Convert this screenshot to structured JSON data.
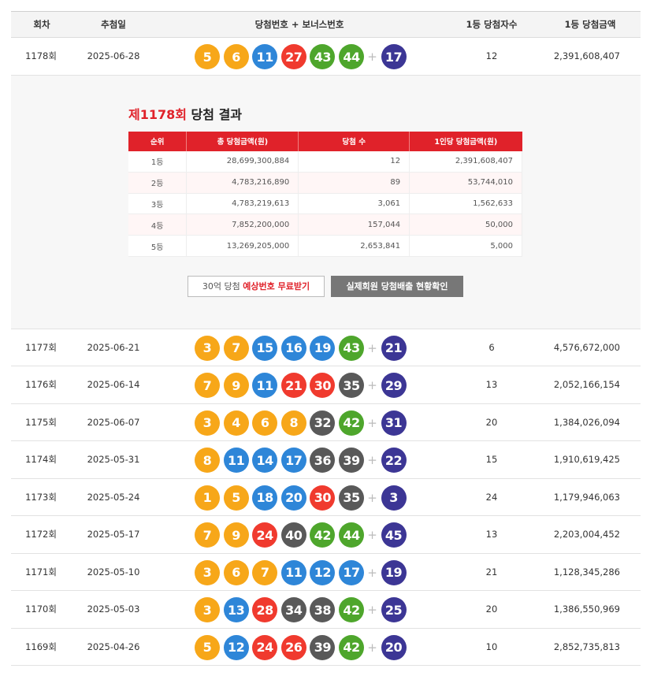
{
  "colors": {
    "yellow": "#f7a719",
    "blue": "#2e86d8",
    "red": "#f03a2e",
    "gray": "#595959",
    "green": "#4ea62c",
    "bonus": "#3c3695"
  },
  "header": {
    "round": "회차",
    "date": "추첨일",
    "numbers": "당첨번호 + 보너스번호",
    "winners": "1등 당첨자수",
    "amount": "1등 당첨금액"
  },
  "plus": "+",
  "draws": [
    {
      "round": "1178회",
      "date": "2025-06-28",
      "nums": [
        5,
        6,
        11,
        27,
        43,
        44
      ],
      "bonus": 17,
      "winners": "12",
      "amount": "2,391,608,407"
    },
    {
      "round": "1177회",
      "date": "2025-06-21",
      "nums": [
        3,
        7,
        15,
        16,
        19,
        43
      ],
      "bonus": 21,
      "winners": "6",
      "amount": "4,576,672,000"
    },
    {
      "round": "1176회",
      "date": "2025-06-14",
      "nums": [
        7,
        9,
        11,
        21,
        30,
        35
      ],
      "bonus": 29,
      "winners": "13",
      "amount": "2,052,166,154"
    },
    {
      "round": "1175회",
      "date": "2025-06-07",
      "nums": [
        3,
        4,
        6,
        8,
        32,
        42
      ],
      "bonus": 31,
      "winners": "20",
      "amount": "1,384,026,094"
    },
    {
      "round": "1174회",
      "date": "2025-05-31",
      "nums": [
        8,
        11,
        14,
        17,
        36,
        39
      ],
      "bonus": 22,
      "winners": "15",
      "amount": "1,910,619,425"
    },
    {
      "round": "1173회",
      "date": "2025-05-24",
      "nums": [
        1,
        5,
        18,
        20,
        30,
        35
      ],
      "bonus": 3,
      "winners": "24",
      "amount": "1,179,946,063"
    },
    {
      "round": "1172회",
      "date": "2025-05-17",
      "nums": [
        7,
        9,
        24,
        40,
        42,
        44
      ],
      "bonus": 45,
      "winners": "13",
      "amount": "2,203,004,452"
    },
    {
      "round": "1171회",
      "date": "2025-05-10",
      "nums": [
        3,
        6,
        7,
        11,
        12,
        17
      ],
      "bonus": 19,
      "winners": "21",
      "amount": "1,128,345,286"
    },
    {
      "round": "1170회",
      "date": "2025-05-03",
      "nums": [
        3,
        13,
        28,
        34,
        38,
        42
      ],
      "bonus": 25,
      "winners": "20",
      "amount": "1,386,550,969"
    },
    {
      "round": "1169회",
      "date": "2025-04-26",
      "nums": [
        5,
        12,
        24,
        26,
        39,
        42
      ],
      "bonus": 20,
      "winners": "10",
      "amount": "2,852,735,813"
    }
  ],
  "detail": {
    "title_red": "제1178회",
    "title_rest": " 당첨 결과",
    "columns": [
      "순위",
      "총 당첨금액(원)",
      "당첨 수",
      "1인당 당첨금액(원)"
    ],
    "rows": [
      {
        "rank": "1등",
        "total": "28,699,300,884",
        "count": "12",
        "each": "2,391,608,407"
      },
      {
        "rank": "2등",
        "total": "4,783,216,890",
        "count": "89",
        "each": "53,744,010"
      },
      {
        "rank": "3등",
        "total": "4,783,219,613",
        "count": "3,061",
        "each": "1,562,633"
      },
      {
        "rank": "4등",
        "total": "7,852,200,000",
        "count": "157,044",
        "each": "50,000"
      },
      {
        "rank": "5등",
        "total": "13,269,205,000",
        "count": "2,653,841",
        "each": "5,000"
      }
    ],
    "btn1_prefix": "30억 당첨 ",
    "btn1_highlight": "예상번호 무료받기",
    "btn2": "실제회원 당첨배출 현황확인"
  }
}
